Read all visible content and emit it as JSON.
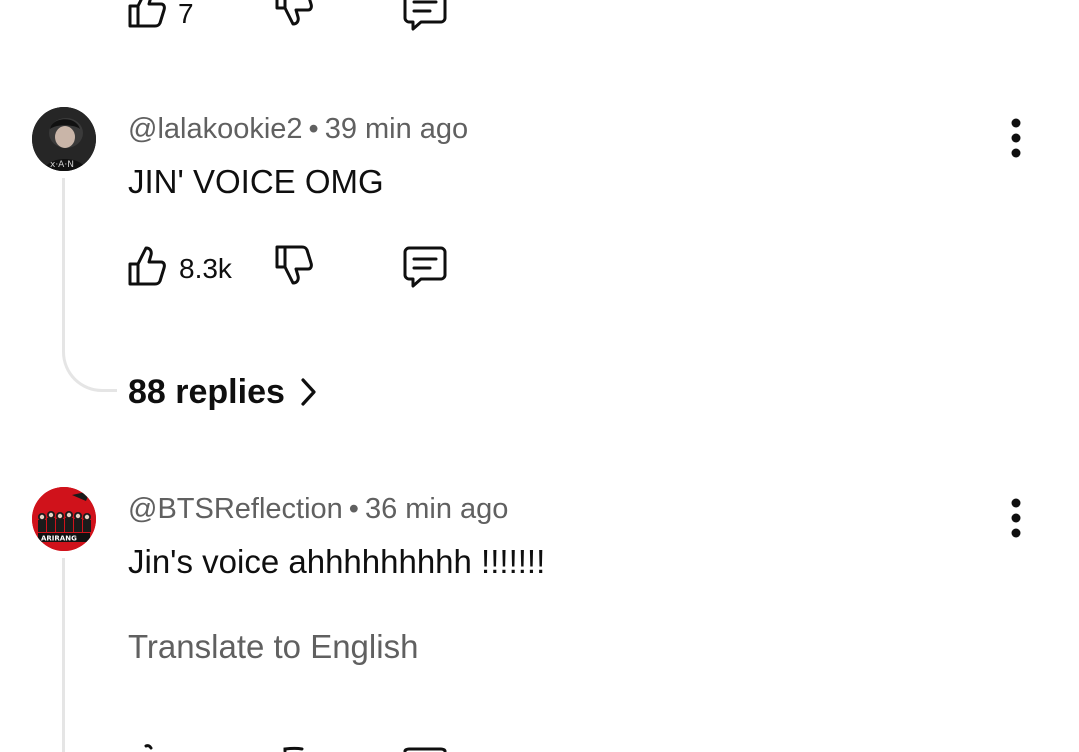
{
  "previous_comment": {
    "like_count": "7"
  },
  "comments": [
    {
      "handle": "@lalakookie2",
      "separator": "•",
      "time": "39 min ago",
      "text": "JIN' VOICE OMG",
      "like_count": "8.3k",
      "replies_label": "88 replies"
    },
    {
      "handle": "@BTSReflection",
      "separator": "•",
      "time": "36 min ago",
      "text": "Jin's voice ahhhhhhhhh !!!!!!!",
      "translate_label": "Translate to English",
      "avatar_banner_text": "ARIRANG"
    }
  ],
  "icons": {
    "like": "thumbs-up-icon",
    "dislike": "thumbs-down-icon",
    "reply": "comment-icon",
    "more": "more-vert-icon",
    "chevron": "chevron-right-icon"
  },
  "colors": {
    "text_primary": "#0f0f0f",
    "text_secondary": "#606060",
    "thread_line": "#e5e5e5",
    "avatar2_red": "#d0121b"
  }
}
